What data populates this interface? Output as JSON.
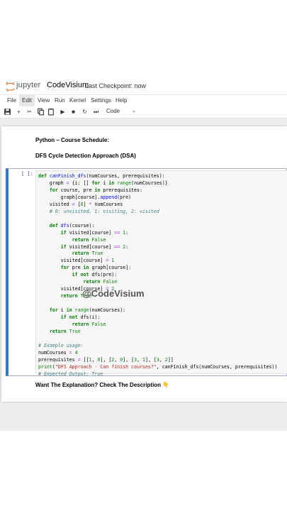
{
  "header": {
    "jupyter_text": "jupyter",
    "notebook_title": "CodeVisium",
    "checkpoint": "Last Checkpoint: now"
  },
  "menu": [
    "File",
    "Edit",
    "View",
    "Run",
    "Kernel",
    "Settings",
    "Help"
  ],
  "toolbar": {
    "icons": [
      "save-icon",
      "add-cell-icon",
      "cut-icon",
      "copy-icon",
      "paste-icon",
      "run-icon",
      "stop-icon",
      "restart-icon",
      "fast-forward-icon"
    ],
    "cell_type": "Code"
  },
  "cells": {
    "md_title": "Python – Course Schedule:",
    "md_subtitle": "DFS Cycle Detection Approach (DSA)",
    "prompt": "[ ]:",
    "watermark": "@CodeVisium",
    "footer_text": "Want The Explanation? Check The Description 👇"
  },
  "code": [
    "def canFinish_dfs(numCourses, prerequisites):",
    "    graph = {i: [] for i in range(numCourses)}",
    "    for course, pre in prerequisites:",
    "        graph[course].append(pre)",
    "    visited = [0] * numCourses",
    "    # 0: unvisited, 1: visiting, 2: visited",
    "",
    "    def dfs(course):",
    "        if visited[course] == 1:",
    "            return False",
    "        if visited[course] == 2:",
    "            return True",
    "        visited[course] = 1",
    "        for pre in graph[course]:",
    "            if not dfs(pre):",
    "                return False",
    "        visited[course] = 2",
    "        return True",
    "",
    "    for i in range(numCourses):",
    "        if not dfs(i):",
    "            return False",
    "    return True",
    "",
    "# Example usage:",
    "numCourses = 4",
    "prerequisites = [[1, 0], [2, 0], [3, 1], [3, 2]]",
    "print(\"DFS Approach - Can finish courses?\", canFinish_dfs(numCourses, prerequisites))",
    "# Expected Output: True"
  ]
}
